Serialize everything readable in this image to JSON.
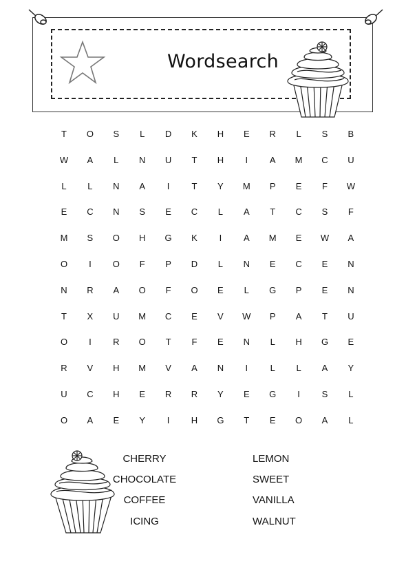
{
  "header": {
    "title": "Wordsearch"
  },
  "grid": [
    [
      "T",
      "O",
      "S",
      "L",
      "D",
      "K",
      "H",
      "E",
      "R",
      "L",
      "S",
      "B"
    ],
    [
      "W",
      "A",
      "L",
      "N",
      "U",
      "T",
      "H",
      "I",
      "A",
      "M",
      "C",
      "U"
    ],
    [
      "L",
      "L",
      "N",
      "A",
      "I",
      "T",
      "Y",
      "M",
      "P",
      "E",
      "F",
      "W"
    ],
    [
      "E",
      "C",
      "N",
      "S",
      "E",
      "C",
      "L",
      "A",
      "T",
      "C",
      "S",
      "F"
    ],
    [
      "M",
      "S",
      "O",
      "H",
      "G",
      "K",
      "I",
      "A",
      "M",
      "E",
      "W",
      "A"
    ],
    [
      "O",
      "I",
      "O",
      "F",
      "P",
      "D",
      "L",
      "N",
      "E",
      "C",
      "E",
      "N"
    ],
    [
      "N",
      "R",
      "A",
      "O",
      "F",
      "O",
      "E",
      "L",
      "G",
      "P",
      "E",
      "N"
    ],
    [
      "T",
      "X",
      "U",
      "M",
      "C",
      "E",
      "V",
      "W",
      "P",
      "A",
      "T",
      "U"
    ],
    [
      "O",
      "I",
      "R",
      "O",
      "T",
      "F",
      "E",
      "N",
      "L",
      "H",
      "G",
      "E"
    ],
    [
      "R",
      "V",
      "H",
      "M",
      "V",
      "A",
      "N",
      "I",
      "L",
      "L",
      "A",
      "Y"
    ],
    [
      "U",
      "C",
      "H",
      "E",
      "R",
      "R",
      "Y",
      "E",
      "G",
      "I",
      "S",
      "L"
    ],
    [
      "O",
      "A",
      "E",
      "Y",
      "I",
      "H",
      "G",
      "T",
      "E",
      "O",
      "A",
      "L"
    ]
  ],
  "word_list": {
    "column1": [
      "CHERRY",
      "CHOCOLATE",
      "COFFEE",
      "ICING"
    ],
    "column2": [
      "LEMON",
      "SWEET",
      "VANILLA",
      "WALNUT"
    ]
  },
  "icons": {
    "pin_left": "push-pin-icon",
    "pin_right": "push-pin-icon",
    "star": "star-outline-icon",
    "cupcake_top": "cupcake-icon",
    "cupcake_bottom": "cupcake-icon"
  }
}
